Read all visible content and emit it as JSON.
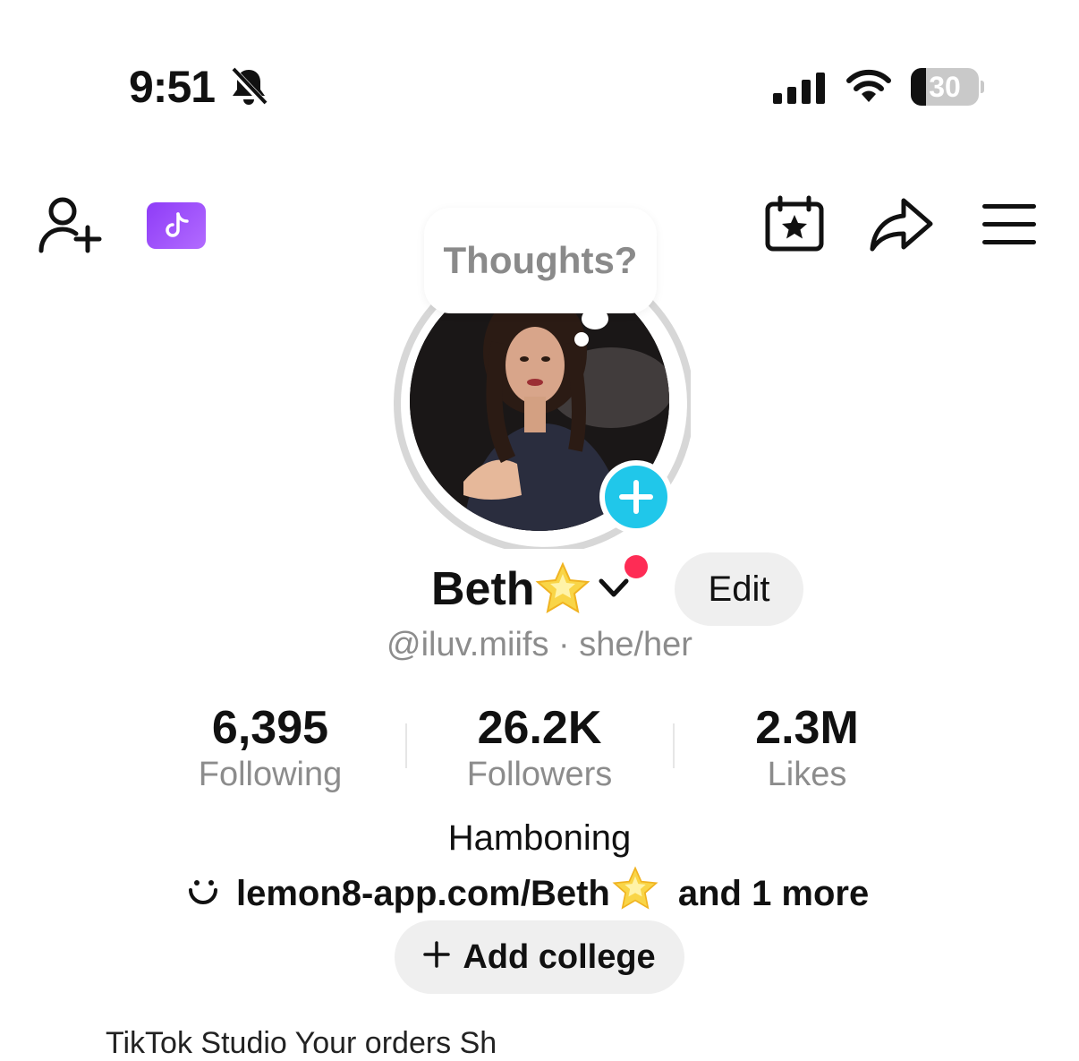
{
  "status_bar": {
    "time": "9:51",
    "battery": "30"
  },
  "top_nav": {
    "ticket_icon": "tiktok-logo-icon"
  },
  "bubble": {
    "text": "Thoughts?"
  },
  "profile": {
    "name": "Beth",
    "edit_label": "Edit",
    "handle_line": "@iluv.miifs · she/her"
  },
  "stats": [
    {
      "value": "6,395",
      "label": "Following"
    },
    {
      "value": "26.2K",
      "label": "Followers"
    },
    {
      "value": "2.3M",
      "label": "Likes"
    }
  ],
  "bio": {
    "text": "Hamboning",
    "link": "lemon8-app.com/Beth",
    "more": "and 1 more"
  },
  "college": {
    "label": "Add college"
  },
  "bottom_peek": "TikTok Studio   Your orders   Sh"
}
